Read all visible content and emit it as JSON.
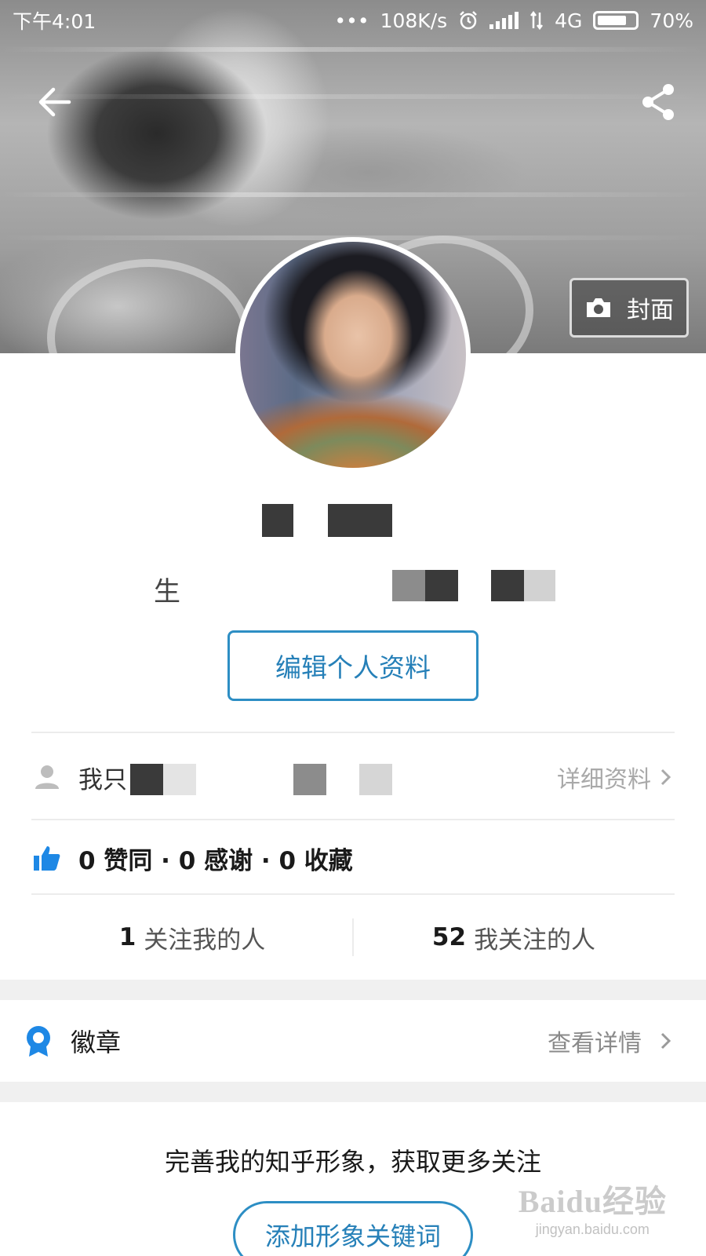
{
  "status_bar": {
    "time": "下午4:01",
    "dots": "•••",
    "speed": "108K/s",
    "network": "4G",
    "battery": "70%"
  },
  "cover": {
    "change_cover_label": "封面"
  },
  "profile": {
    "edit_button": "编辑个人资料",
    "bio_visible_char": "生",
    "intro_prefix": "我只",
    "detail_link": "详细资料",
    "stats_text": "0 赞同 · 0 感谢 · 0 收藏",
    "followers_count": "1",
    "followers_label": "关注我的人",
    "following_count": "52",
    "following_label": "我关注的人"
  },
  "badges": {
    "label": "徽章",
    "detail_link": "查看详情"
  },
  "promo": {
    "text": "完善我的知乎形象，获取更多关注",
    "button": "添加形象关键词"
  },
  "watermark": {
    "main": "Baidu经验",
    "sub": "jingyan.baidu.com"
  },
  "colors": {
    "accent": "#2d8ec4",
    "like_icon": "#1e88e5",
    "badge_icon": "#1e88e5"
  }
}
